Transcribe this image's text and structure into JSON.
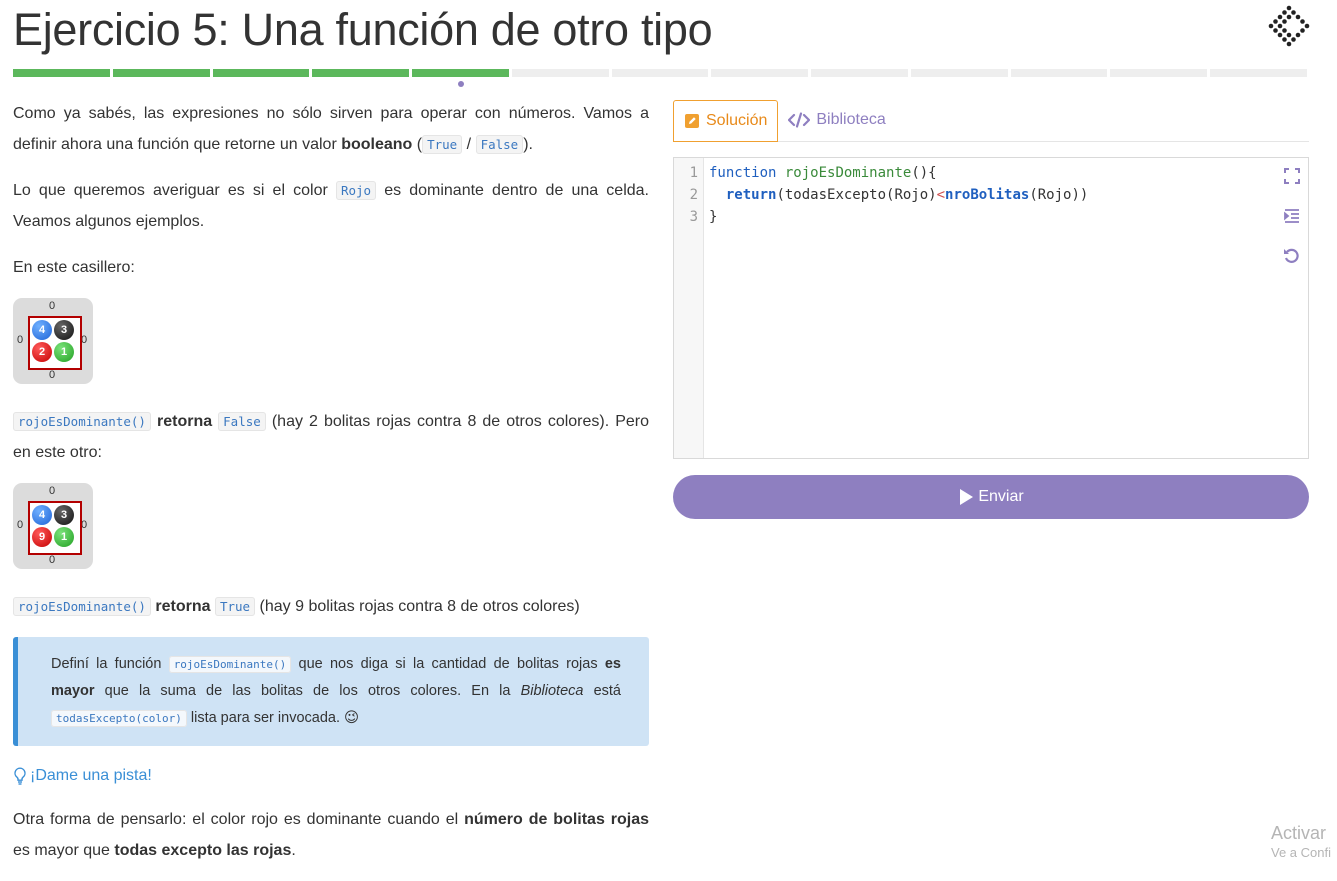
{
  "page": {
    "title": "Ejercicio 5: Una función de otro tipo"
  },
  "progress": {
    "total_steps": 13,
    "completed_steps": 5,
    "current_step": 5,
    "completed_color": "#5cb85c",
    "pending_color": "#eeeeee"
  },
  "statement": {
    "p1_a": "Como ya sabés, las expresiones no sólo sirven para operar con números. Vamos a definir ahora una función que retorne un valor ",
    "p1_bold": "booleano",
    "p1_b": " (",
    "p1_code_true": "True",
    "p1_sep": " / ",
    "p1_code_false": "False",
    "p1_c": ").",
    "p2_a": "Lo que queremos averiguar es si el color ",
    "p2_code": "Rojo",
    "p2_b": " es dominante dentro de una celda. Veamos algunos ejemplos.",
    "p3": "En este casillero:",
    "board1": {
      "top": "0",
      "bottom": "0",
      "left": "0",
      "right": "0",
      "azul": "4",
      "negro": "3",
      "rojo": "2",
      "verde": "1"
    },
    "r1_code": "rojoEsDominante()",
    "r1_bold": "retorna",
    "r1_code_value": "False",
    "r1_text": "(hay 2 bolitas rojas contra 8 de otros colores). Pero en este otro:",
    "board2": {
      "top": "0",
      "bottom": "0",
      "left": "0",
      "right": "0",
      "azul": "4",
      "negro": "3",
      "rojo": "9",
      "verde": "1"
    },
    "r2_code": "rojoEsDominante()",
    "r2_bold": "retorna",
    "r2_code_value": "True",
    "r2_text": "(hay 9 bolitas rojas contra 8 de otros colores)"
  },
  "callout": {
    "a": "Definí la función ",
    "code1": "rojoEsDominante()",
    "b": " que nos diga si la cantidad de bolitas rojas ",
    "bold1": "es mayor",
    "c": " que la suma de las bolitas de los otros colores. En la ",
    "italic": "Biblioteca",
    "d": " está ",
    "code2": "todasExcepto(color)",
    "e": " lista para ser invocada. ",
    "emoji": "😉"
  },
  "hint": {
    "label": "¡Dame una pista!",
    "icon": "lightbulb-icon"
  },
  "extra": {
    "a": "Otra forma de pensarlo: el color rojo es dominante cuando el ",
    "bold1": "número de bolitas rojas",
    "b": " es mayor que ",
    "bold2": "todas excepto las rojas",
    "c": "."
  },
  "tabs": {
    "solution": "Solución",
    "library": "Biblioteca",
    "active_color": "#e88a1a",
    "inactive_color": "#8e7fc0"
  },
  "editor": {
    "line_numbers": [
      "1",
      "2",
      "3"
    ],
    "l1_kw": "function",
    "l1_name": "rojoEsDominante",
    "l1_rest": "(){",
    "l2_indent": "  ",
    "l2_kw": "return",
    "l2_a": "(todasExcepto(Rojo)",
    "l2_op": "<",
    "l2_fn": "nroBolitas",
    "l2_b": "(Rojo))",
    "l3": "}",
    "tools": [
      "fullscreen-icon",
      "indent-icon",
      "reset-icon"
    ]
  },
  "submit": {
    "label": "Enviar",
    "color": "#8e7fc0"
  },
  "watermark": {
    "line1": "Activar",
    "line2": "Ve a Confi"
  }
}
